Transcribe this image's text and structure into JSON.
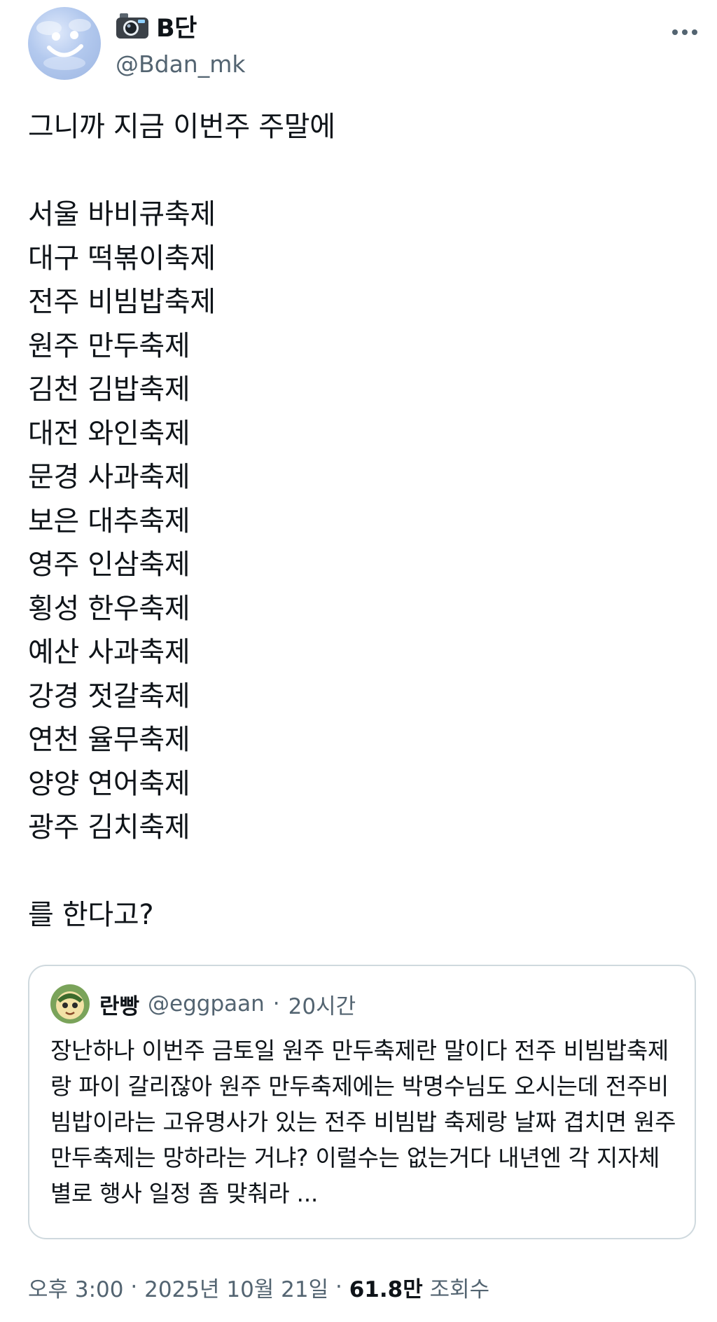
{
  "author": {
    "display_name": "B단",
    "handle": "@Bdan_mk",
    "name_emoji": "camera-with-flash-icon"
  },
  "tweet": {
    "text": "그니까 지금 이번주 주말에\n\n서울 바비큐축제\n대구 떡볶이축제\n전주 비빔밥축제\n원주 만두축제\n김천 김밥축제\n대전 와인축제\n문경 사과축제\n보은 대추축제\n영주 인삼축제\n횡성 한우축제\n예산 사과축제\n강경 젓갈축제\n연천 율무축제\n양양 연어축제\n광주 김치축제\n\n를 한다고?"
  },
  "quote": {
    "display_name": "란빵",
    "handle": "@eggpaan",
    "separator": "·",
    "time": "20시간",
    "text": "장난하나 이번주 금토일 원주 만두축제란 말이다 전주 비빔밥축제랑 파이 갈리잖아 원주 만두축제에는 박명수님도 오시는데 전주비빔밥이라는 고유명사가 있는 전주 비빔밥 축제랑 날짜 겹치면 원주 만두축제는 망하라는 거냐? 이럴수는 없는거다 내년엔 각 지자체별로 행사 일정 좀 맞춰라 ..."
  },
  "meta": {
    "time": "오후 3:00",
    "date": "2025년 10월 21일",
    "separator": "·",
    "views_count": "61.8만",
    "views_label": "조회수"
  },
  "icons": {
    "more": "more-horizontal-icon"
  },
  "colors": {
    "text": "#0f1419",
    "secondary_text": "#536471",
    "border": "#cfd9de",
    "avatar_blue": "#a9c1ea"
  }
}
